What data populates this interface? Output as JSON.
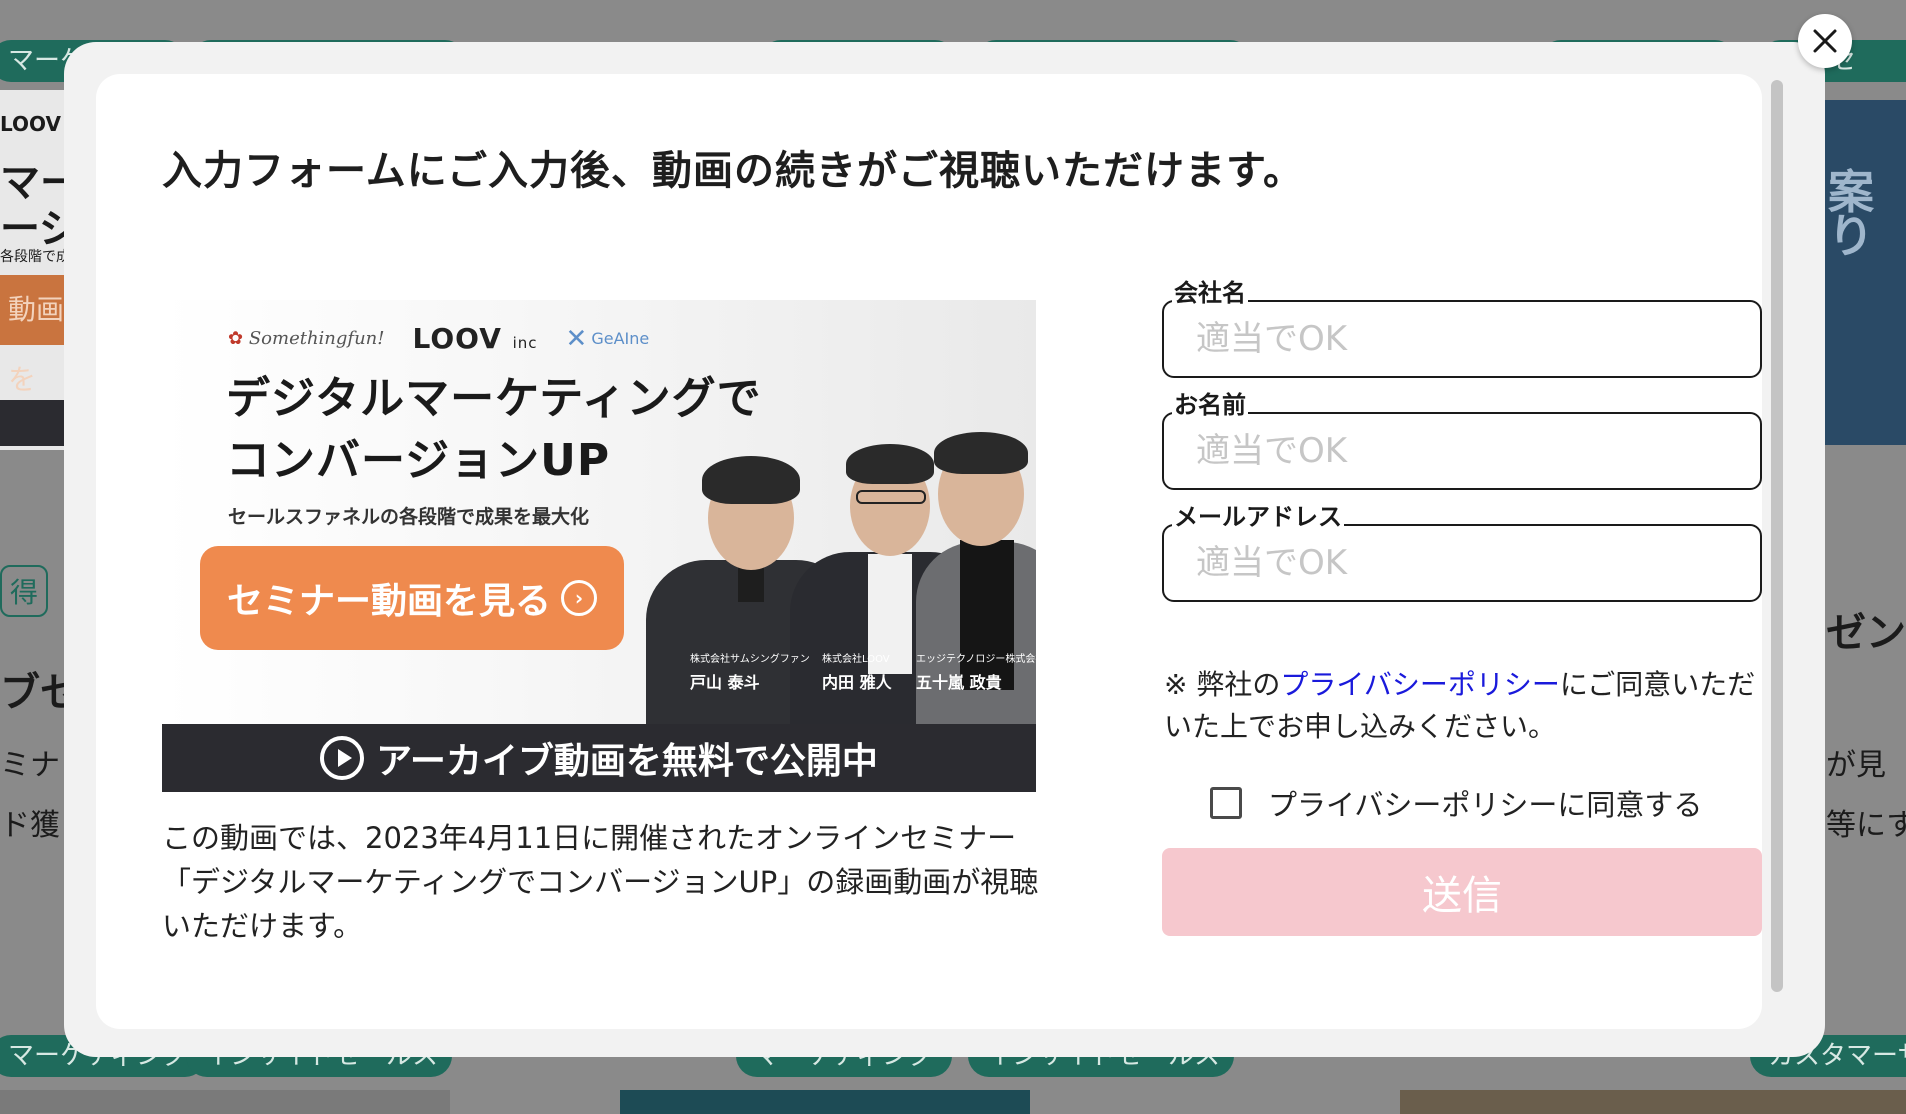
{
  "modal": {
    "title": "入力フォームにご入力後、動画の続きがご視聴いただけます。",
    "close_label": "×",
    "banner": {
      "brand_somethingfun": "Somethingfun!",
      "brand_loov": "LOOV",
      "brand_loov_suffix": "inc",
      "brand_geaine": "GeAIne",
      "headline": "デジタルマーケティングで\nコンバージョンUP",
      "subline": "セールスファネルの各段階で成果を最大化",
      "cta_label": "セミナー動画を見る",
      "cta_arrow": "›",
      "speakers": [
        {
          "company": "株式会社サムシングファン",
          "name": "戸山 泰斗"
        },
        {
          "company": "株式会社LOOV",
          "name": "内田 雅人"
        },
        {
          "company": "エッジテクノロジー株式会社",
          "name": "五十嵐 政貴"
        }
      ],
      "bar_label": "アーカイブ動画を無料で公開中"
    },
    "description": "この動画では、2023年4月11日に開催されたオンラインセミナー「デジタルマーケティングでコンバージョンUP」の録画動画が視聴いただけます。",
    "form": {
      "company": {
        "label": "会社名",
        "placeholder": "適当でOK"
      },
      "name": {
        "label": "お名前",
        "placeholder": "適当でOK"
      },
      "email": {
        "label": "メールアドレス",
        "placeholder": "適当でOK"
      },
      "notice_prefix": "※ 弊社の",
      "notice_link": "プライバシーポリシー",
      "notice_suffix": "にご同意いただいた上でお申し込みください。",
      "agree_label": "プライバシーポリシーに同意する",
      "agree_checked": false,
      "submit_label": "送信"
    }
  },
  "background": {
    "left_pill": "マーケ",
    "right_pill": "イドセ",
    "left_logo": "LOOV",
    "left_heading_1": "マー",
    "left_heading_2": "ージョ",
    "left_small": "各段階で成",
    "left_orange": "動画を",
    "left_tag": "得",
    "left_title": "ブセミ",
    "left_body_1": "ミナ",
    "left_body_2": "ド獲",
    "right_heading_1": "案",
    "right_heading_2": "り",
    "right_title": "ゼン",
    "right_body_1": "が見",
    "right_body_2": "等にす",
    "bottom_pill_left": "マーケティング",
    "bottom_pill_left_2": "インサイドセールス",
    "bottom_pill_mid": "マーケティング",
    "bottom_pill_mid_2": "インサイドセールス",
    "bottom_pill_right": "カスタマーサ"
  },
  "colors": {
    "accent_orange": "#ef8a4e",
    "submit_disabled": "#f6c8ce",
    "link_blue": "#1a1adb",
    "overlay": "#8a8a8a"
  }
}
